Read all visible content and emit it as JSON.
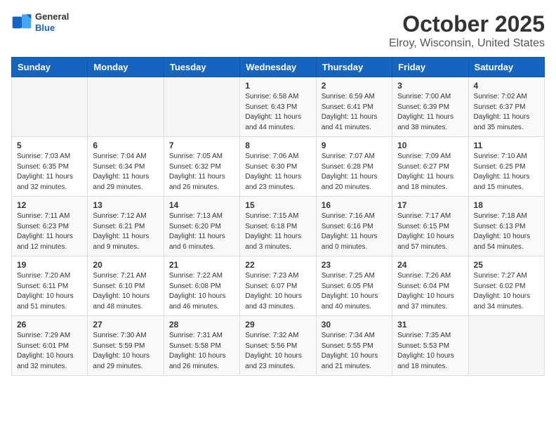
{
  "header": {
    "logo_general": "General",
    "logo_blue": "Blue",
    "month": "October 2025",
    "location": "Elroy, Wisconsin, United States"
  },
  "days_of_week": [
    "Sunday",
    "Monday",
    "Tuesday",
    "Wednesday",
    "Thursday",
    "Friday",
    "Saturday"
  ],
  "weeks": [
    [
      {
        "day": "",
        "sunrise": "",
        "sunset": "",
        "daylight": "",
        "empty": true
      },
      {
        "day": "",
        "sunrise": "",
        "sunset": "",
        "daylight": "",
        "empty": true
      },
      {
        "day": "",
        "sunrise": "",
        "sunset": "",
        "daylight": "",
        "empty": true
      },
      {
        "day": "1",
        "sunrise": "Sunrise: 6:58 AM",
        "sunset": "Sunset: 6:43 PM",
        "daylight": "Daylight: 11 hours and 44 minutes."
      },
      {
        "day": "2",
        "sunrise": "Sunrise: 6:59 AM",
        "sunset": "Sunset: 6:41 PM",
        "daylight": "Daylight: 11 hours and 41 minutes."
      },
      {
        "day": "3",
        "sunrise": "Sunrise: 7:00 AM",
        "sunset": "Sunset: 6:39 PM",
        "daylight": "Daylight: 11 hours and 38 minutes."
      },
      {
        "day": "4",
        "sunrise": "Sunrise: 7:02 AM",
        "sunset": "Sunset: 6:37 PM",
        "daylight": "Daylight: 11 hours and 35 minutes."
      }
    ],
    [
      {
        "day": "5",
        "sunrise": "Sunrise: 7:03 AM",
        "sunset": "Sunset: 6:35 PM",
        "daylight": "Daylight: 11 hours and 32 minutes."
      },
      {
        "day": "6",
        "sunrise": "Sunrise: 7:04 AM",
        "sunset": "Sunset: 6:34 PM",
        "daylight": "Daylight: 11 hours and 29 minutes."
      },
      {
        "day": "7",
        "sunrise": "Sunrise: 7:05 AM",
        "sunset": "Sunset: 6:32 PM",
        "daylight": "Daylight: 11 hours and 26 minutes."
      },
      {
        "day": "8",
        "sunrise": "Sunrise: 7:06 AM",
        "sunset": "Sunset: 6:30 PM",
        "daylight": "Daylight: 11 hours and 23 minutes."
      },
      {
        "day": "9",
        "sunrise": "Sunrise: 7:07 AM",
        "sunset": "Sunset: 6:28 PM",
        "daylight": "Daylight: 11 hours and 20 minutes."
      },
      {
        "day": "10",
        "sunrise": "Sunrise: 7:09 AM",
        "sunset": "Sunset: 6:27 PM",
        "daylight": "Daylight: 11 hours and 18 minutes."
      },
      {
        "day": "11",
        "sunrise": "Sunrise: 7:10 AM",
        "sunset": "Sunset: 6:25 PM",
        "daylight": "Daylight: 11 hours and 15 minutes."
      }
    ],
    [
      {
        "day": "12",
        "sunrise": "Sunrise: 7:11 AM",
        "sunset": "Sunset: 6:23 PM",
        "daylight": "Daylight: 11 hours and 12 minutes."
      },
      {
        "day": "13",
        "sunrise": "Sunrise: 7:12 AM",
        "sunset": "Sunset: 6:21 PM",
        "daylight": "Daylight: 11 hours and 9 minutes."
      },
      {
        "day": "14",
        "sunrise": "Sunrise: 7:13 AM",
        "sunset": "Sunset: 6:20 PM",
        "daylight": "Daylight: 11 hours and 6 minutes."
      },
      {
        "day": "15",
        "sunrise": "Sunrise: 7:15 AM",
        "sunset": "Sunset: 6:18 PM",
        "daylight": "Daylight: 11 hours and 3 minutes."
      },
      {
        "day": "16",
        "sunrise": "Sunrise: 7:16 AM",
        "sunset": "Sunset: 6:16 PM",
        "daylight": "Daylight: 11 hours and 0 minutes."
      },
      {
        "day": "17",
        "sunrise": "Sunrise: 7:17 AM",
        "sunset": "Sunset: 6:15 PM",
        "daylight": "Daylight: 10 hours and 57 minutes."
      },
      {
        "day": "18",
        "sunrise": "Sunrise: 7:18 AM",
        "sunset": "Sunset: 6:13 PM",
        "daylight": "Daylight: 10 hours and 54 minutes."
      }
    ],
    [
      {
        "day": "19",
        "sunrise": "Sunrise: 7:20 AM",
        "sunset": "Sunset: 6:11 PM",
        "daylight": "Daylight: 10 hours and 51 minutes."
      },
      {
        "day": "20",
        "sunrise": "Sunrise: 7:21 AM",
        "sunset": "Sunset: 6:10 PM",
        "daylight": "Daylight: 10 hours and 48 minutes."
      },
      {
        "day": "21",
        "sunrise": "Sunrise: 7:22 AM",
        "sunset": "Sunset: 6:08 PM",
        "daylight": "Daylight: 10 hours and 46 minutes."
      },
      {
        "day": "22",
        "sunrise": "Sunrise: 7:23 AM",
        "sunset": "Sunset: 6:07 PM",
        "daylight": "Daylight: 10 hours and 43 minutes."
      },
      {
        "day": "23",
        "sunrise": "Sunrise: 7:25 AM",
        "sunset": "Sunset: 6:05 PM",
        "daylight": "Daylight: 10 hours and 40 minutes."
      },
      {
        "day": "24",
        "sunrise": "Sunrise: 7:26 AM",
        "sunset": "Sunset: 6:04 PM",
        "daylight": "Daylight: 10 hours and 37 minutes."
      },
      {
        "day": "25",
        "sunrise": "Sunrise: 7:27 AM",
        "sunset": "Sunset: 6:02 PM",
        "daylight": "Daylight: 10 hours and 34 minutes."
      }
    ],
    [
      {
        "day": "26",
        "sunrise": "Sunrise: 7:29 AM",
        "sunset": "Sunset: 6:01 PM",
        "daylight": "Daylight: 10 hours and 32 minutes."
      },
      {
        "day": "27",
        "sunrise": "Sunrise: 7:30 AM",
        "sunset": "Sunset: 5:59 PM",
        "daylight": "Daylight: 10 hours and 29 minutes."
      },
      {
        "day": "28",
        "sunrise": "Sunrise: 7:31 AM",
        "sunset": "Sunset: 5:58 PM",
        "daylight": "Daylight: 10 hours and 26 minutes."
      },
      {
        "day": "29",
        "sunrise": "Sunrise: 7:32 AM",
        "sunset": "Sunset: 5:56 PM",
        "daylight": "Daylight: 10 hours and 23 minutes."
      },
      {
        "day": "30",
        "sunrise": "Sunrise: 7:34 AM",
        "sunset": "Sunset: 5:55 PM",
        "daylight": "Daylight: 10 hours and 21 minutes."
      },
      {
        "day": "31",
        "sunrise": "Sunrise: 7:35 AM",
        "sunset": "Sunset: 5:53 PM",
        "daylight": "Daylight: 10 hours and 18 minutes."
      },
      {
        "day": "",
        "sunrise": "",
        "sunset": "",
        "daylight": "",
        "empty": true
      }
    ]
  ]
}
